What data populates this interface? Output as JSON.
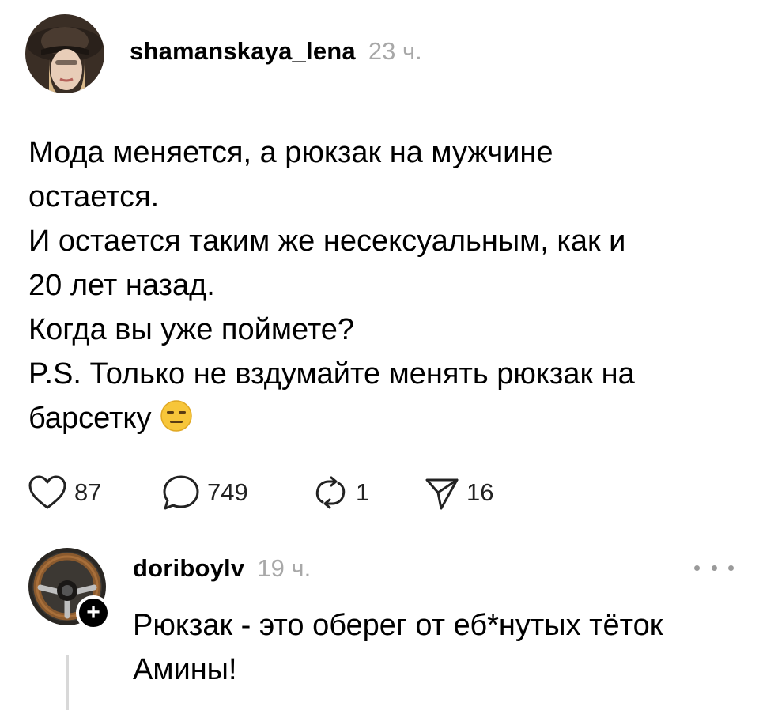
{
  "post": {
    "username": "shamanskaya_lena",
    "time": "23 ч.",
    "lines": [
      "Мода меняется, а рюкзак на мужчине",
      "остается.",
      "И остается таким же несексуальным, как и",
      "20 лет назад.",
      "Когда вы уже поймете?",
      "P.S. Только не вздумайте менять рюкзак на",
      "барсетку"
    ],
    "emoji": "expressionless-face"
  },
  "actions": {
    "likes": "87",
    "comments": "749",
    "reposts": "1",
    "shares": "16"
  },
  "reply": {
    "username": "doriboylv",
    "time": "19 ч.",
    "lines": [
      "Рюкзак - это оберег от еб*нутых тёток",
      "Амины!"
    ]
  },
  "colors": {
    "text": "#000000",
    "muted": "#a8a8a8",
    "divider": "#d8d8d8"
  }
}
